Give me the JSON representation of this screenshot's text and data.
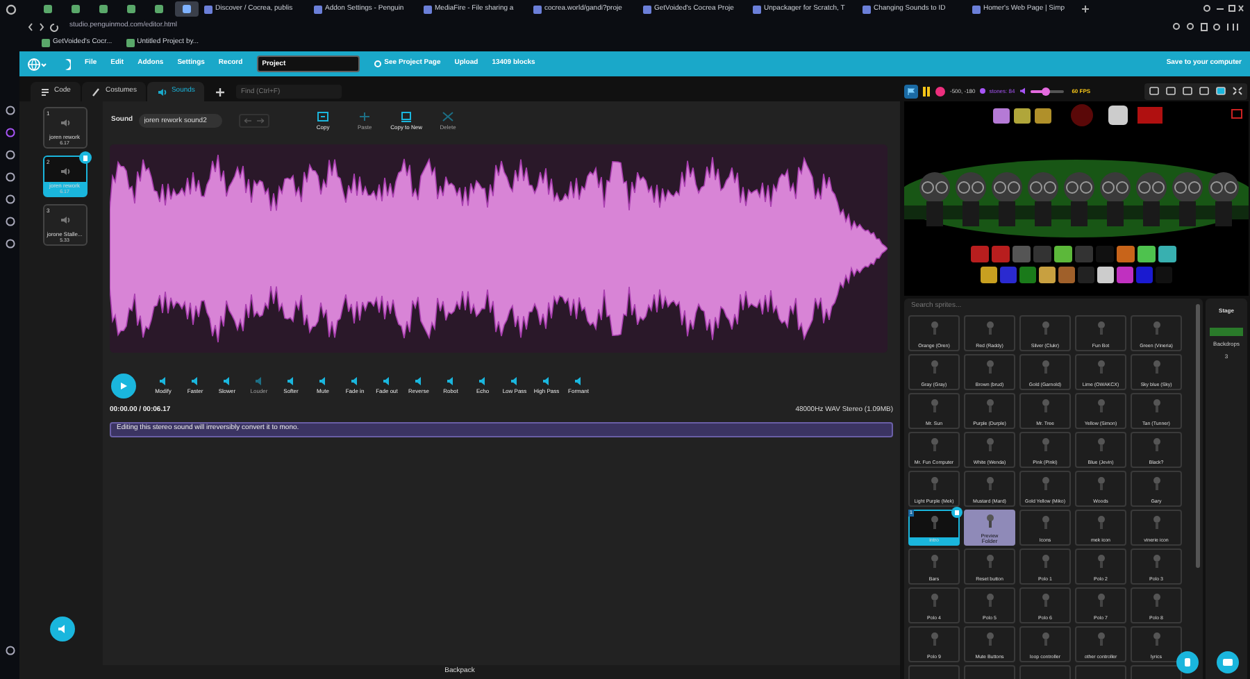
{
  "browser": {
    "pinned_tabs": [
      {
        "selected": false
      },
      {
        "selected": false
      },
      {
        "selected": false
      },
      {
        "selected": false
      },
      {
        "selected": false
      },
      {
        "selected": true
      }
    ],
    "tabs": [
      {
        "label": "Discover / Cocrea, publis"
      },
      {
        "label": "Addon Settings - Penguin"
      },
      {
        "label": "MediaFire - File sharing a"
      },
      {
        "label": "cocrea.world/gandi?proje"
      },
      {
        "label": "GetVoided's Cocrea Proje"
      },
      {
        "label": "Unpackager for Scratch, T"
      },
      {
        "label": "Changing Sounds to ID"
      },
      {
        "label": "Homer's Web Page | Simp"
      }
    ],
    "address": "studio.penguinmod.com/editor.html",
    "bookmarks": [
      "GetVoided's Cocr...",
      "Untitled Project by..."
    ]
  },
  "menu": {
    "items": [
      "File",
      "Edit",
      "Addons",
      "Settings",
      "Record"
    ],
    "project_title": "Project",
    "links": [
      "See Project Page",
      "Upload"
    ],
    "block_count": "13409 blocks",
    "save": "Save to your computer"
  },
  "editor_tabs": [
    {
      "label": "Code",
      "selected": false,
      "kind": "code"
    },
    {
      "label": "Costumes",
      "selected": false,
      "kind": "costumes"
    },
    {
      "label": "Sounds",
      "selected": true,
      "kind": "sounds"
    }
  ],
  "find": {
    "placeholder": "Find (Ctrl+F)"
  },
  "sounds": [
    {
      "number": "1",
      "name": "joren rework",
      "duration": "6.17",
      "selected": false
    },
    {
      "number": "2",
      "name": "joren rework",
      "duration": "6.17",
      "selected": true
    },
    {
      "number": "3",
      "name": "jorone Stalle...",
      "duration": "5.33",
      "selected": false
    }
  ],
  "sound_editor": {
    "label": "Sound",
    "name": "joren rework sound2",
    "tools": [
      {
        "label": "Copy",
        "disabled": false,
        "kind": "copy"
      },
      {
        "label": "Paste",
        "disabled": true,
        "kind": "paste"
      },
      {
        "label": "Copy to New",
        "disabled": false,
        "kind": "copy-new"
      },
      {
        "label": "Delete",
        "disabled": true,
        "kind": "delete"
      }
    ],
    "effects": [
      {
        "label": "Modify",
        "disabled": false
      },
      {
        "label": "Faster",
        "disabled": false
      },
      {
        "label": "Slower",
        "disabled": false
      },
      {
        "label": "Louder",
        "disabled": true
      },
      {
        "label": "Softer",
        "disabled": false
      },
      {
        "label": "Mute",
        "disabled": false
      },
      {
        "label": "Fade in",
        "disabled": false
      },
      {
        "label": "Fade out",
        "disabled": false
      },
      {
        "label": "Reverse",
        "disabled": false
      },
      {
        "label": "Robot",
        "disabled": false
      },
      {
        "label": "Echo",
        "disabled": false
      },
      {
        "label": "Low Pass",
        "disabled": false
      },
      {
        "label": "High Pass",
        "disabled": false
      },
      {
        "label": "Formant",
        "disabled": false
      }
    ],
    "time": "00:00.00 / 00:06.17",
    "format": "48000Hz WAV Stereo (1.09MB)",
    "warning": "Editing this stereo sound will irreversibly convert it to mono."
  },
  "stage_header": {
    "coords": "-500, -180",
    "variable": "stones: 84",
    "volume": {
      "level": 0.45
    },
    "fps": "60 FPS"
  },
  "sprites": {
    "placeholder": "Search sprites...",
    "items": [
      {
        "name": "Orange (Oren)",
        "selected": false,
        "kind": "sprite"
      },
      {
        "name": "Red (Raddy)",
        "selected": false,
        "kind": "sprite"
      },
      {
        "name": "Silver (Clukr)",
        "selected": false,
        "kind": "sprite"
      },
      {
        "name": "Fun Bot",
        "selected": false,
        "kind": "sprite"
      },
      {
        "name": "Green (Vineria)",
        "selected": false,
        "kind": "sprite"
      },
      {
        "name": "Gray (Gray)",
        "selected": false,
        "kind": "sprite"
      },
      {
        "name": "Brown (brud)",
        "selected": false,
        "kind": "sprite"
      },
      {
        "name": "Gold (Garnold)",
        "selected": false,
        "kind": "sprite"
      },
      {
        "name": "Lime (OWAKCX)",
        "selected": false,
        "kind": "sprite"
      },
      {
        "name": "Sky blue (Sky)",
        "selected": false,
        "kind": "sprite"
      },
      {
        "name": "Mr. Sun",
        "selected": false,
        "kind": "sprite"
      },
      {
        "name": "Purple (Durple)",
        "selected": false,
        "kind": "sprite"
      },
      {
        "name": "Mr. Tree",
        "selected": false,
        "kind": "sprite"
      },
      {
        "name": "Yellow (Simon)",
        "selected": false,
        "kind": "sprite"
      },
      {
        "name": "Tan (Tunner)",
        "selected": false,
        "kind": "sprite"
      },
      {
        "name": "Mr. Fun Computer",
        "selected": false,
        "kind": "sprite"
      },
      {
        "name": "White (Wenda)",
        "selected": false,
        "kind": "sprite"
      },
      {
        "name": "Pink (Pinki)",
        "selected": false,
        "kind": "sprite"
      },
      {
        "name": "Blue (Jevin)",
        "selected": false,
        "kind": "sprite"
      },
      {
        "name": "Black?",
        "selected": false,
        "kind": "sprite"
      },
      {
        "name": "Light Purple (Mek)",
        "selected": false,
        "kind": "sprite"
      },
      {
        "name": "Mustard (Mard)",
        "selected": false,
        "kind": "sprite"
      },
      {
        "name": "Gold Yellow (Miko)",
        "selected": false,
        "kind": "sprite"
      },
      {
        "name": "Woods",
        "selected": false,
        "kind": "sprite"
      },
      {
        "name": "Gary",
        "selected": false,
        "kind": "sprite"
      },
      {
        "name": "intro",
        "selected": true,
        "kind": "sprite",
        "number": "1"
      },
      {
        "name": "Preview",
        "selected": false,
        "kind": "folder",
        "subtitle": "Folder"
      },
      {
        "name": "Icons",
        "selected": false,
        "kind": "sprite"
      },
      {
        "name": "mek icon",
        "selected": false,
        "kind": "sprite"
      },
      {
        "name": "vinerie icon",
        "selected": false,
        "kind": "sprite"
      },
      {
        "name": "Bars",
        "selected": false,
        "kind": "sprite"
      },
      {
        "name": "Reset button",
        "selected": false,
        "kind": "sprite"
      },
      {
        "name": "Polo 1",
        "selected": false,
        "kind": "sprite"
      },
      {
        "name": "Polo 2",
        "selected": false,
        "kind": "sprite"
      },
      {
        "name": "Polo 3",
        "selected": false,
        "kind": "sprite"
      },
      {
        "name": "Polo 4",
        "selected": false,
        "kind": "sprite"
      },
      {
        "name": "Polo 5",
        "selected": false,
        "kind": "sprite"
      },
      {
        "name": "Polo 6",
        "selected": false,
        "kind": "sprite"
      },
      {
        "name": "Polo 7",
        "selected": false,
        "kind": "sprite"
      },
      {
        "name": "Polo 8",
        "selected": false,
        "kind": "sprite"
      },
      {
        "name": "Polo 9",
        "selected": false,
        "kind": "sprite"
      },
      {
        "name": "Mute Buttons",
        "selected": false,
        "kind": "sprite"
      },
      {
        "name": "loop controller",
        "selected": false,
        "kind": "sprite"
      },
      {
        "name": "other controller",
        "selected": false,
        "kind": "sprite"
      },
      {
        "name": "lyrics",
        "selected": false,
        "kind": "sprite"
      }
    ]
  },
  "stage_pane": {
    "title": "Stage",
    "backdrops_label": "Backdrops",
    "backdrops_count": "3"
  },
  "backpack": "Backpack"
}
